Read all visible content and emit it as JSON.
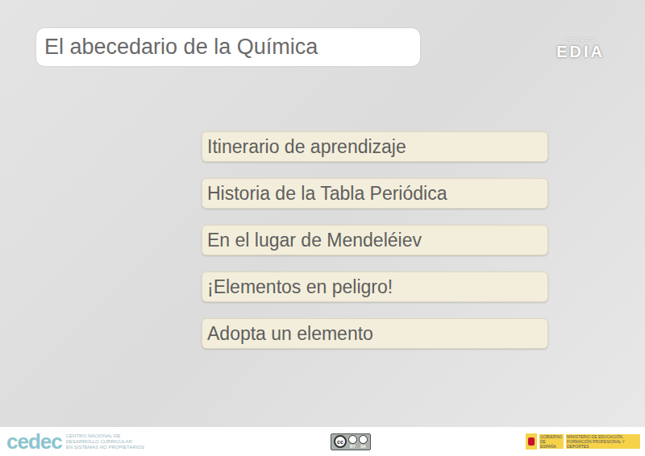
{
  "header": {
    "title": "El abecedario de la Química",
    "logo": {
      "small": "PROYECTO",
      "name": "EDIA"
    }
  },
  "menu": [
    {
      "label": "Itinerario de aprendizaje"
    },
    {
      "label": "Historia de la Tabla Periódica"
    },
    {
      "label": "En el lugar de Mendeléiev"
    },
    {
      "label": "¡Elementos en peligro!"
    },
    {
      "label": "Adopta un elemento"
    }
  ],
  "footer": {
    "cedec": {
      "name": "cedec",
      "subtitle": [
        "CENTRO NACIONAL DE",
        "DESARROLLO CURRICULAR",
        "EN SISTEMAS NO PROPIETARIOS"
      ]
    },
    "license": {
      "cc": "cc",
      "parts": [
        "BY",
        "SA"
      ]
    },
    "ministry": [
      "GOBIERNO DE ESPAÑA",
      "MINISTERIO DE EDUCACIÓN, FORMACIÓN PROFESIONAL Y DEPORTES"
    ]
  }
}
